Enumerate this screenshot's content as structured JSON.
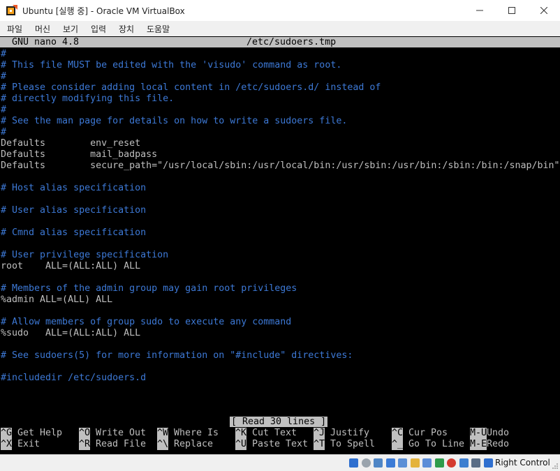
{
  "window": {
    "title": "Ubuntu [실행 중] - Oracle VM VirtualBox",
    "controls": [
      "—",
      "☐",
      "✕"
    ]
  },
  "menu": [
    "파일",
    "머신",
    "보기",
    "입력",
    "장치",
    "도움말"
  ],
  "nano": {
    "version": "GNU nano 4.8",
    "filename": "/etc/sudoers.tmp",
    "status": "[ Read 30 lines ]",
    "lines": [
      "#",
      "# This file MUST be edited with the 'visudo' command as root.",
      "#",
      "# Please consider adding local content in /etc/sudoers.d/ instead of",
      "# directly modifying this file.",
      "#",
      "# See the man page for details on how to write a sudoers file.",
      "#",
      "Defaults        env_reset",
      "Defaults        mail_badpass",
      "Defaults        secure_path=\"/usr/local/sbin:/usr/local/bin:/usr/sbin:/usr/bin:/sbin:/bin:/snap/bin\"",
      "",
      "# Host alias specification",
      "",
      "# User alias specification",
      "",
      "# Cmnd alias specification",
      "",
      "# User privilege specification",
      "root    ALL=(ALL:ALL) ALL",
      "",
      "# Members of the admin group may gain root privileges",
      "%admin ALL=(ALL) ALL",
      "",
      "# Allow members of group sudo to execute any command",
      "%sudo   ALL=(ALL:ALL) ALL",
      "",
      "# See sudoers(5) for more information on \"#include\" directives:",
      "",
      "#includedir /etc/sudoers.d"
    ],
    "shortcuts_row1": [
      {
        "key": "^G",
        "label": "Get Help"
      },
      {
        "key": "^O",
        "label": "Write Out"
      },
      {
        "key": "^W",
        "label": "Where Is"
      },
      {
        "key": "^K",
        "label": "Cut Text"
      },
      {
        "key": "^J",
        "label": "Justify"
      },
      {
        "key": "^C",
        "label": "Cur Pos"
      },
      {
        "key": "M-U",
        "label": "Undo"
      }
    ],
    "shortcuts_row2": [
      {
        "key": "^X",
        "label": "Exit"
      },
      {
        "key": "^R",
        "label": "Read File"
      },
      {
        "key": "^\\",
        "label": "Replace"
      },
      {
        "key": "^U",
        "label": "Paste Text"
      },
      {
        "key": "^T",
        "label": "To Spell"
      },
      {
        "key": "^_",
        "label": "Go To Line"
      },
      {
        "key": "M-E",
        "label": "Redo"
      }
    ]
  },
  "statusbar": {
    "host_key": "Right Control",
    "icons": [
      "hard-disk-icon",
      "optical-drive-icon",
      "audio-icon",
      "network-icon",
      "usb-icon",
      "shared-folders-icon",
      "display-icon",
      "video-capture-icon",
      "recording-icon",
      "cpu-icon",
      "mouse-integration-icon",
      "host-key-arrow-icon"
    ]
  },
  "colors": {
    "comment": "#3d79d6",
    "text": "#bfbfbf",
    "background": "#000000",
    "header": "#c0c0c0"
  }
}
